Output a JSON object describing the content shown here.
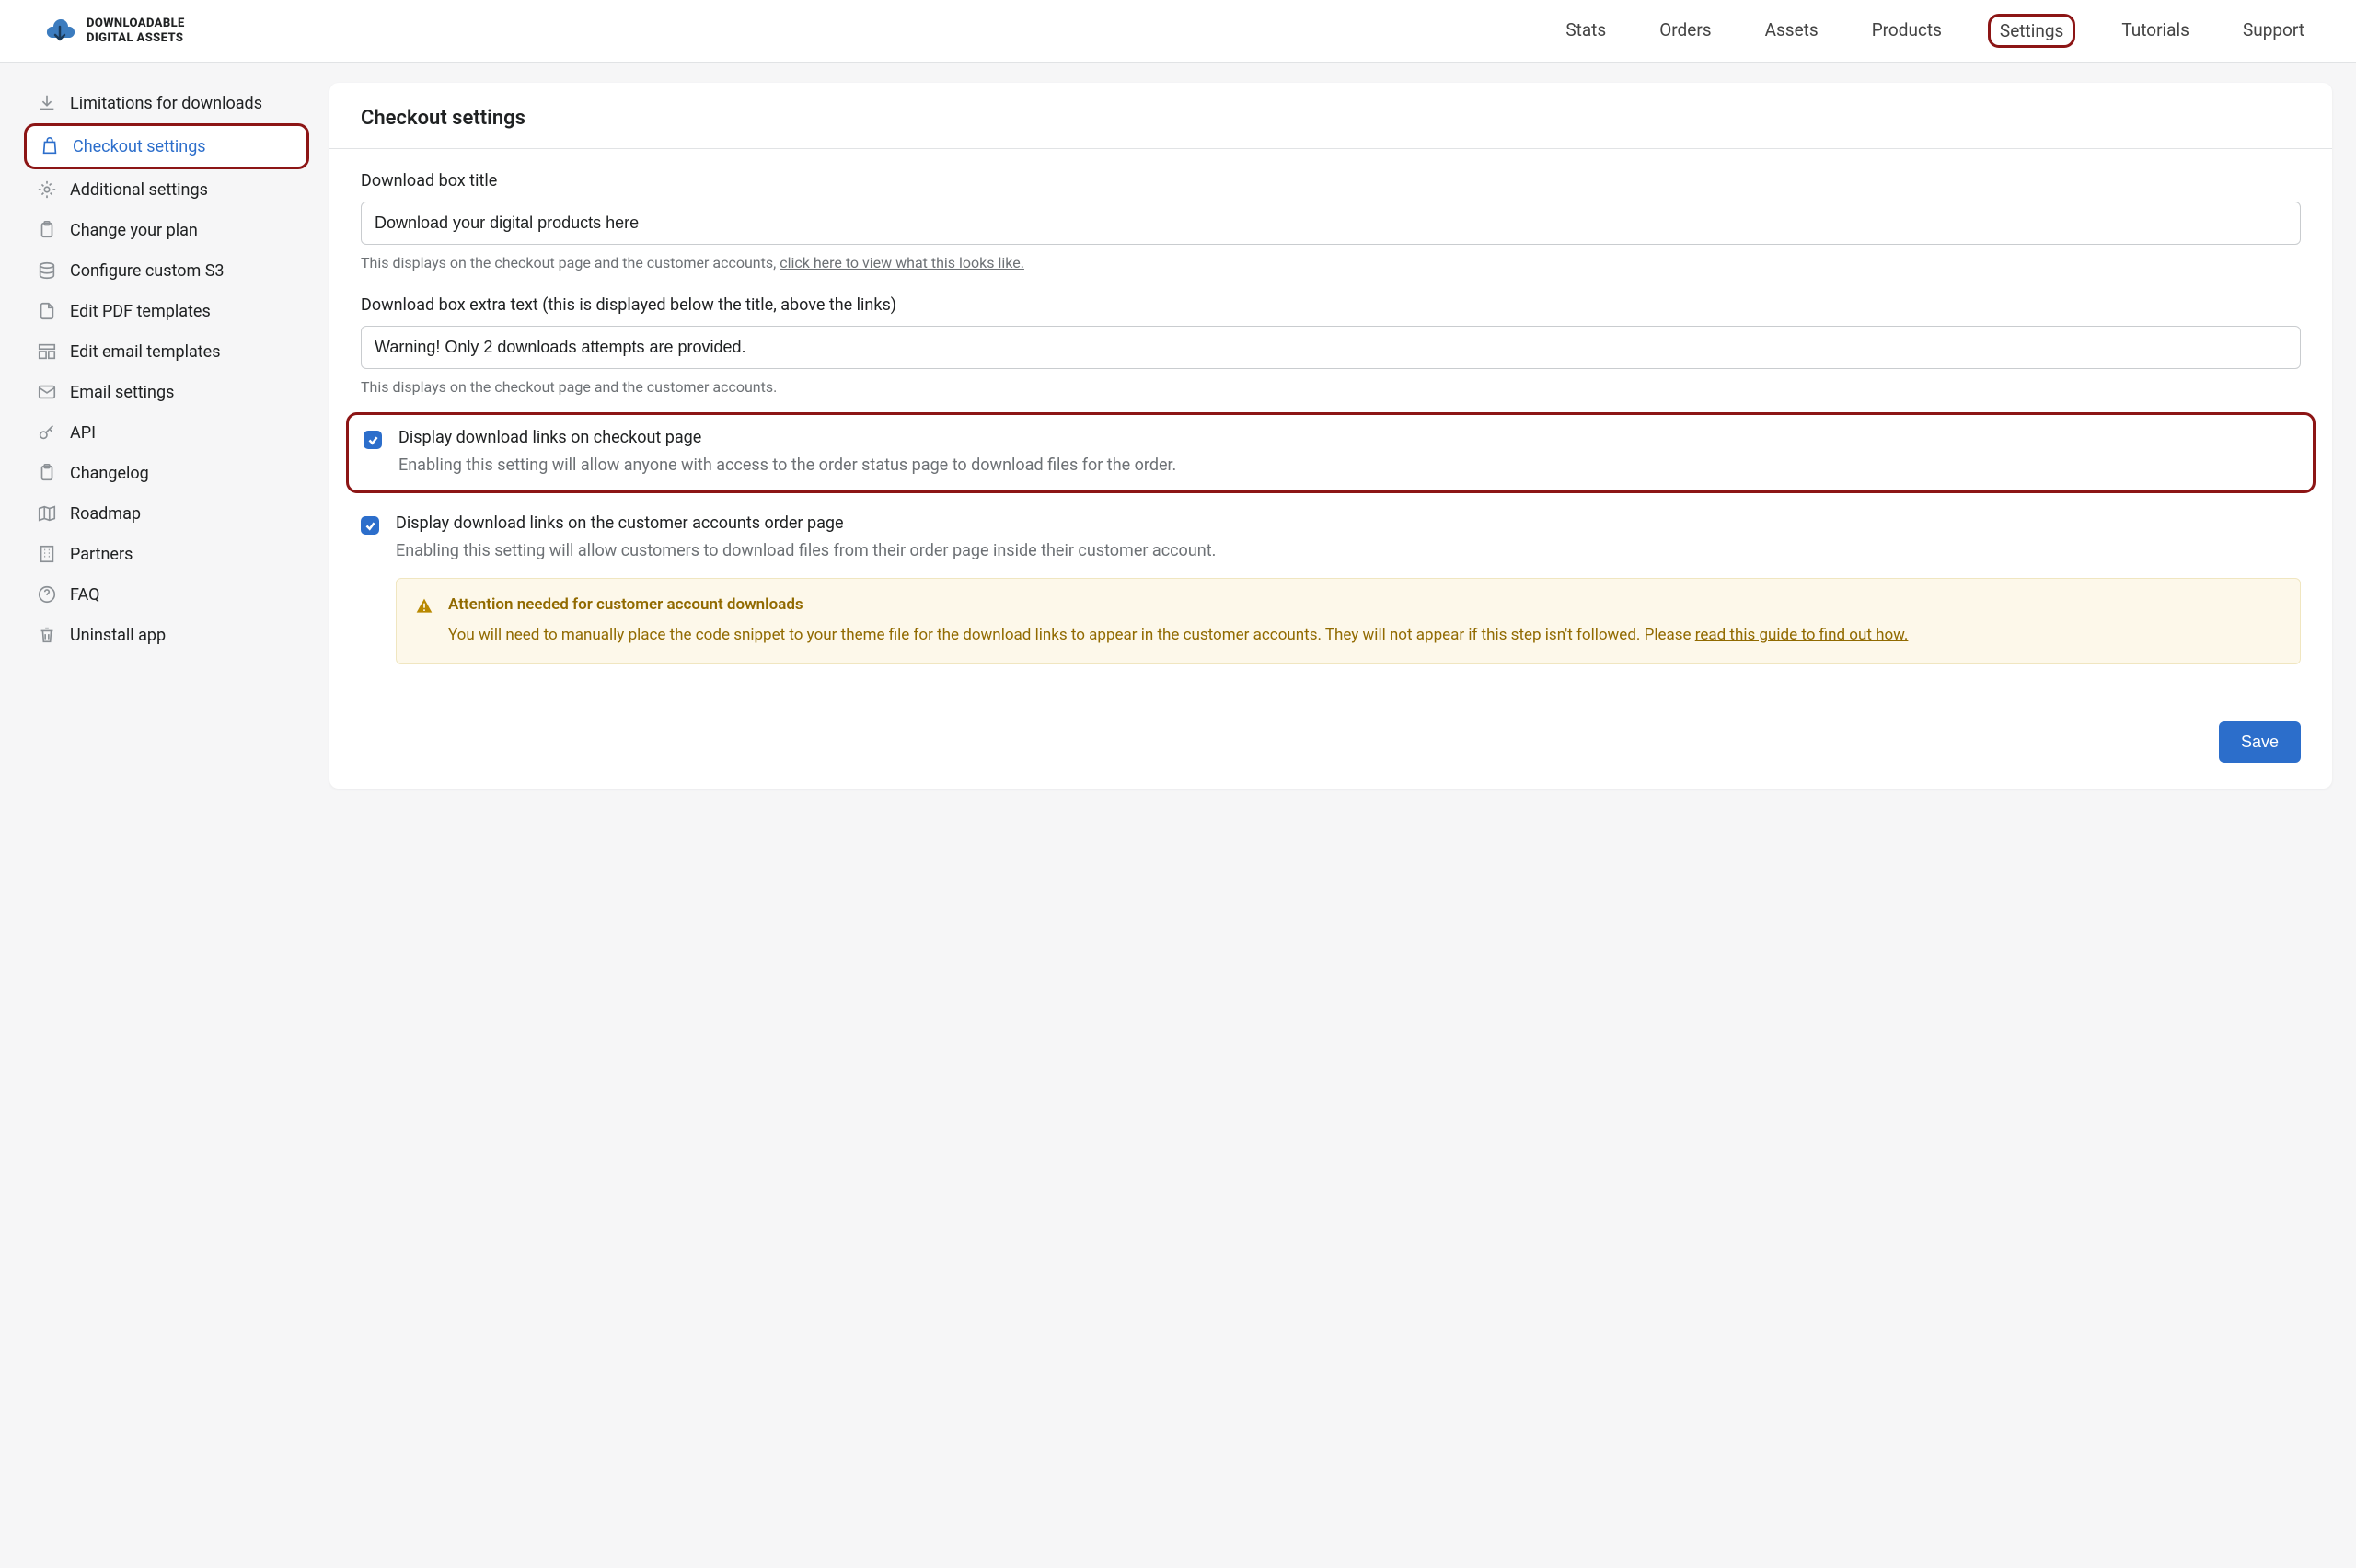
{
  "brand": {
    "line1": "DOWNLOADABLE",
    "line2": "DIGITAL ASSETS"
  },
  "topnav": [
    {
      "label": "Stats",
      "highlighted": false
    },
    {
      "label": "Orders",
      "highlighted": false
    },
    {
      "label": "Assets",
      "highlighted": false
    },
    {
      "label": "Products",
      "highlighted": false
    },
    {
      "label": "Settings",
      "highlighted": true
    },
    {
      "label": "Tutorials",
      "highlighted": false
    },
    {
      "label": "Support",
      "highlighted": false
    }
  ],
  "sidebar": [
    {
      "label": "Limitations for downloads",
      "icon": "download-icon",
      "active": false
    },
    {
      "label": "Checkout settings",
      "icon": "bag-icon",
      "active": true
    },
    {
      "label": "Additional settings",
      "icon": "gear-icon",
      "active": false
    },
    {
      "label": "Change your plan",
      "icon": "clipboard-icon",
      "active": false
    },
    {
      "label": "Configure custom S3",
      "icon": "database-icon",
      "active": false
    },
    {
      "label": "Edit PDF templates",
      "icon": "file-icon",
      "active": false
    },
    {
      "label": "Edit email templates",
      "icon": "layout-icon",
      "active": false
    },
    {
      "label": "Email settings",
      "icon": "mail-icon",
      "active": false
    },
    {
      "label": "API",
      "icon": "key-icon",
      "active": false
    },
    {
      "label": "Changelog",
      "icon": "clipboard-icon",
      "active": false
    },
    {
      "label": "Roadmap",
      "icon": "map-icon",
      "active": false
    },
    {
      "label": "Partners",
      "icon": "building-icon",
      "active": false
    },
    {
      "label": "FAQ",
      "icon": "help-icon",
      "active": false
    },
    {
      "label": "Uninstall app",
      "icon": "trash-icon",
      "active": false
    }
  ],
  "page": {
    "title": "Checkout settings",
    "field1": {
      "label": "Download box title",
      "value": "Download your digital products here",
      "help_pre": "This displays on the checkout page and the customer accounts, ",
      "help_link": "click here to view what this looks like."
    },
    "field2": {
      "label": "Download box extra text (this is displayed below the title, above the links)",
      "value": "Warning! Only 2 downloads attempts are provided.",
      "help": "This displays on the checkout page and the customer accounts."
    },
    "cb1": {
      "checked": true,
      "highlighted": true,
      "label": "Display download links on checkout page",
      "desc": "Enabling this setting will allow anyone with access to the order status page to download files for the order."
    },
    "cb2": {
      "checked": true,
      "highlighted": false,
      "label": "Display download links on the customer accounts order page",
      "desc": "Enabling this setting will allow customers to download files from their order page inside their customer account."
    },
    "alert": {
      "title": "Attention needed for customer account downloads",
      "text_pre": "You will need to manually place the code snippet to your theme file for the download links to appear in the customer accounts. They will not appear if this step isn't followed. Please ",
      "text_link": "read this guide to find out how."
    },
    "save": "Save"
  }
}
